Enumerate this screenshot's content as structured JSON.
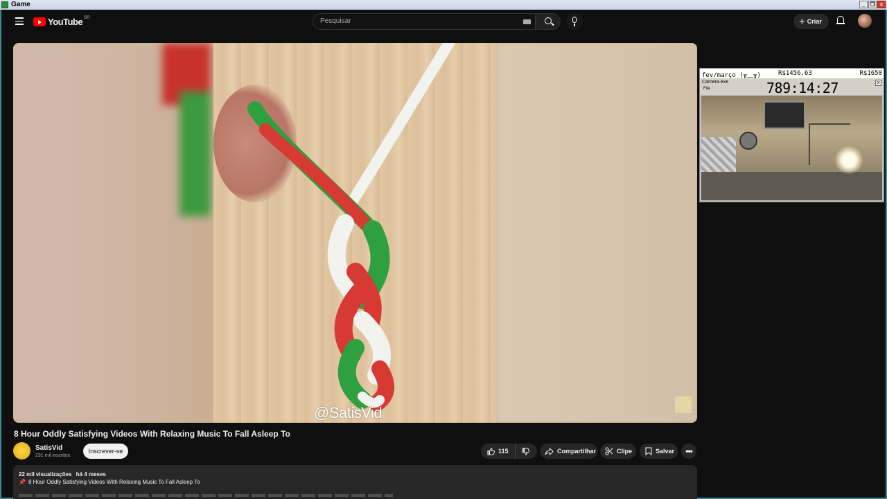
{
  "window": {
    "title": "Game",
    "controls": [
      "_",
      "❐",
      "×"
    ]
  },
  "header": {
    "logo_text": "YouTube",
    "country_code": "BR",
    "search_placeholder": "Pesquisar",
    "create_label": "Criar"
  },
  "player": {
    "watermark": "@SatisVid"
  },
  "overlay": {
    "period": "fev/março (╥﹏╥)",
    "amount": "R$1456.63",
    "goal": "R$1650",
    "window_title": "Camera.exe",
    "menu_file": "File",
    "timer": "789:14:27",
    "close": "x"
  },
  "video": {
    "title": "8 Hour Oddly Satisfying Videos With Relaxing Music To Fall Asleep To",
    "channel_name": "SatisVid",
    "subscribers": "231 mil inscritos",
    "subscribe_label": "Inscrever-se",
    "likes": "115",
    "share_label": "Compartilhar",
    "clip_label": "Clipe",
    "save_label": "Salvar",
    "more_label": "•••"
  },
  "description": {
    "views": "22 mil visualizações",
    "age": "há 4 meses",
    "pinned_line": "8 Hour Oddly Satisfying Videos With Relaxing Music To Fall Asleep To"
  },
  "colors": {
    "background": "#0f0f0f",
    "brand_red": "#ff0000",
    "pill": "#272727",
    "braid_red": "#d63a32",
    "braid_green": "#2fa03f",
    "braid_white": "#f2f2ee"
  }
}
